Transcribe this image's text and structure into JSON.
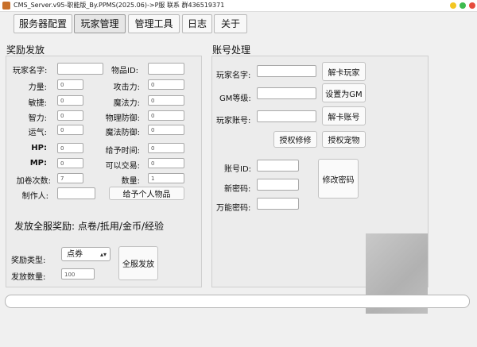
{
  "window": {
    "title": "CMS_Server.v95-职能版_By.PPMS(2025.06)->P服 联系 群436519371"
  },
  "tabs": [
    {
      "label": "服务器配置",
      "active": false
    },
    {
      "label": "玩家管理",
      "active": true
    },
    {
      "label": "管理工具",
      "active": false
    },
    {
      "label": "日志",
      "active": false
    },
    {
      "label": "关于",
      "active": false
    }
  ],
  "reward": {
    "section_title": "奖励发放",
    "player_name_label": "玩家名字:",
    "item_id_label": "物品ID:",
    "stats": [
      {
        "label": "力量:",
        "value": "0"
      },
      {
        "label": "攻击力:",
        "value": "0"
      },
      {
        "label": "敏捷:",
        "value": "0"
      },
      {
        "label": "魔法力:",
        "value": "0"
      },
      {
        "label": "智力:",
        "value": "0"
      },
      {
        "label": "物理防御:",
        "value": "0"
      },
      {
        "label": "运气:",
        "value": "0"
      },
      {
        "label": "魔法防御:",
        "value": "0"
      },
      {
        "label": "HP:",
        "value": "0"
      },
      {
        "label": "给予时间:",
        "value": "0"
      },
      {
        "label": "MP:",
        "value": "0"
      },
      {
        "label": "可以交易:",
        "value": "0"
      },
      {
        "label": "加卷次数:",
        "value": "7"
      },
      {
        "label": "数量:",
        "value": "1"
      }
    ],
    "maker_label": "制作人:",
    "give_button": "给予个人物品",
    "global_title": "发放全服奖励: 点卷/抵用/金币/经验",
    "reward_type_label": "奖励类型:",
    "reward_type_value": "点券",
    "amount_label": "发放数量:",
    "amount_value": "100",
    "global_button": "全服发放"
  },
  "account": {
    "section_title": "账号处理",
    "player_name_label": "玩家名字:",
    "unstuck_player_button": "解卡玩家",
    "gm_level_label": "GM等级:",
    "set_gm_button": "设置为GM",
    "account_label": "玩家账号:",
    "unstuck_account_button": "解卡账号",
    "grant_fix_button": "授权修修",
    "grant_pet_button": "授权宠物",
    "id_label": "账号ID:",
    "new_password_label": "新密码:",
    "master_password_label": "万能密码:",
    "change_password_button": "修改密码"
  },
  "colors": {
    "window_bg": "#f0f0f0",
    "panel_bg": "#ececec",
    "close": "#e64b3c",
    "maximize": "#3dbb4f",
    "minimize": "#f3c623"
  }
}
